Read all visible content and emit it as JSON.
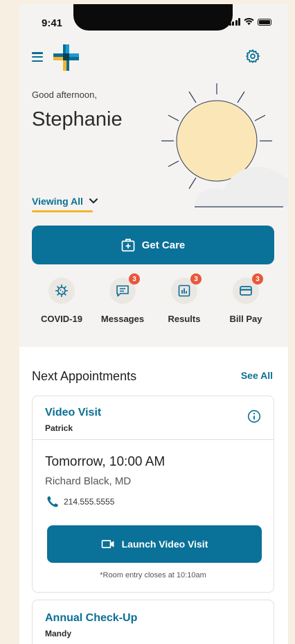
{
  "status": {
    "time": "9:41"
  },
  "greeting": {
    "small": "Good afternoon,",
    "name": "Stephanie"
  },
  "viewing": {
    "label": "Viewing All"
  },
  "get_care": {
    "label": "Get Care"
  },
  "quick_actions": [
    {
      "label": "COVID-19",
      "icon": "virus-icon",
      "badge": ""
    },
    {
      "label": "Messages",
      "icon": "message-icon",
      "badge": "3"
    },
    {
      "label": "Results",
      "icon": "chart-icon",
      "badge": "3"
    },
    {
      "label": "Bill Pay",
      "icon": "credit-card-icon",
      "badge": "3"
    }
  ],
  "appointments": {
    "title": "Next Appointments",
    "see_all": "See All",
    "items": [
      {
        "title": "Video Visit",
        "patient": "Patrick",
        "time": "Tomorrow, 10:00 AM",
        "doctor": "Richard Black, MD",
        "phone": "214.555.5555",
        "action": "Launch Video Visit",
        "note": "*Room entry closes at 10:10am"
      },
      {
        "title": "Annual Check-Up",
        "patient": "Mandy"
      }
    ]
  },
  "colors": {
    "primary": "#0a7198",
    "accent": "#f3b52d",
    "badge": "#e8573b"
  }
}
